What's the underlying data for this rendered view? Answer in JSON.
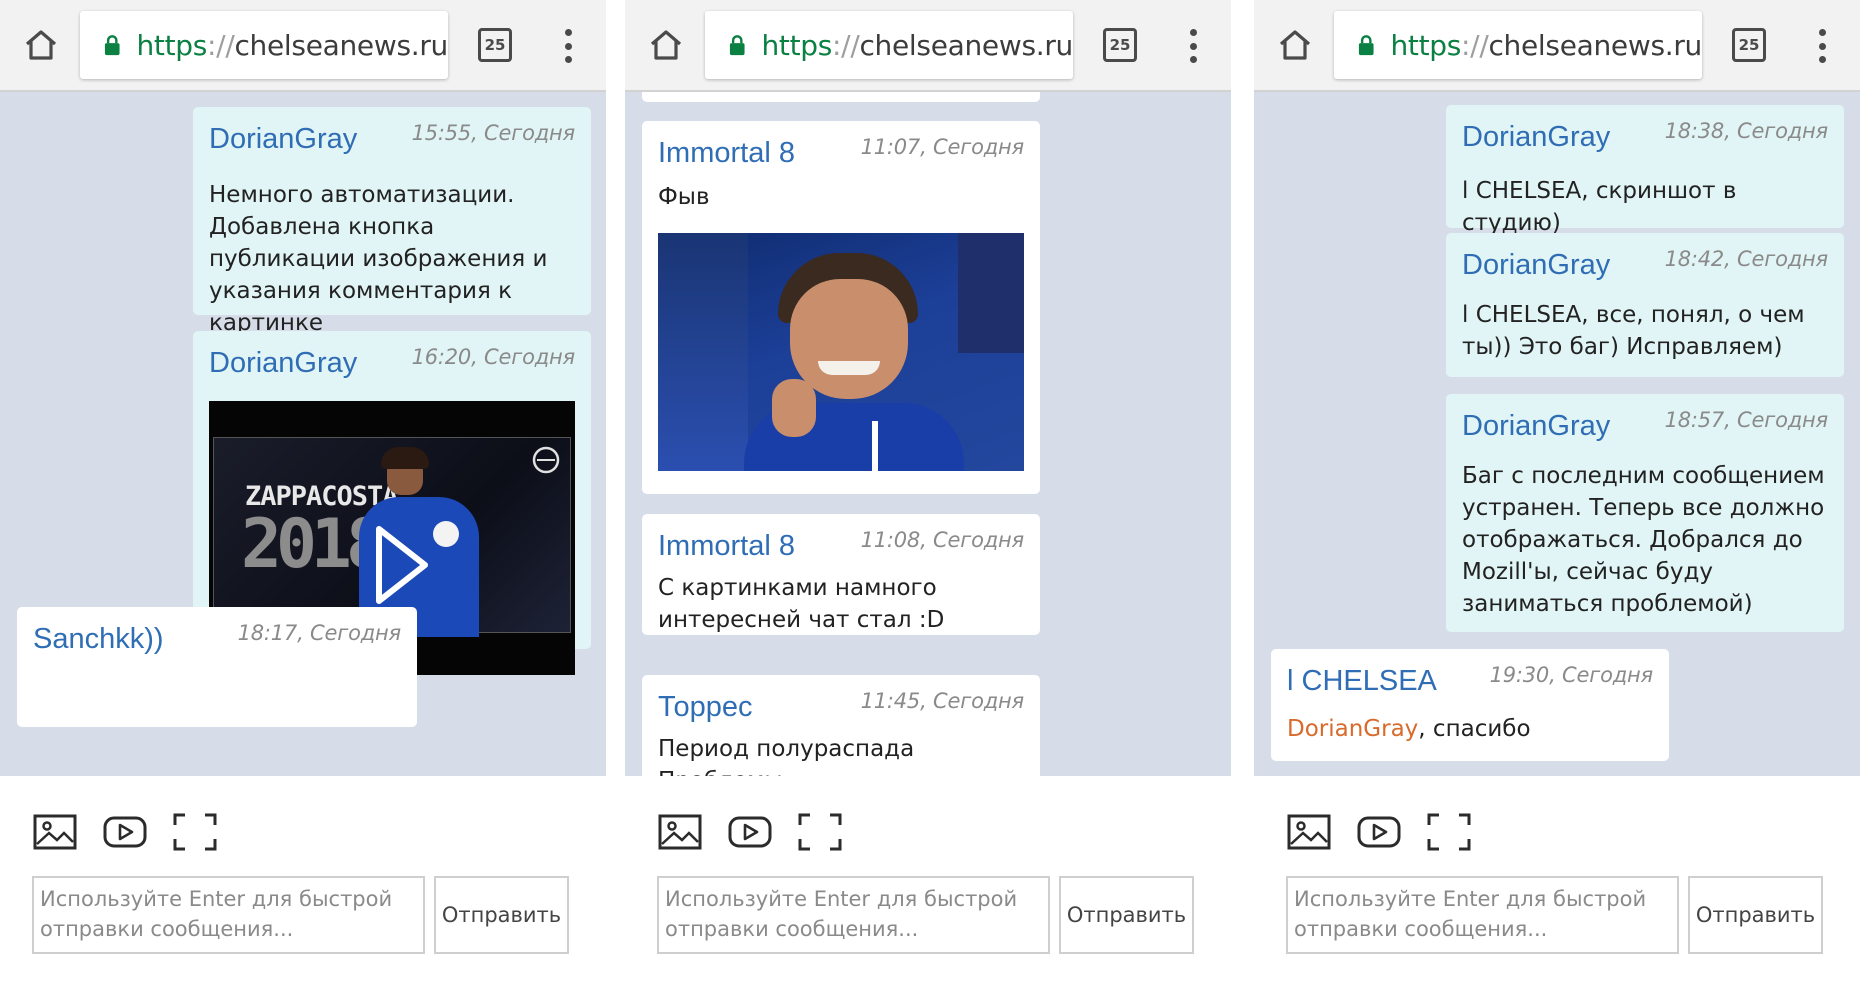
{
  "browser": {
    "url_scheme": "https",
    "url_sep": "://",
    "url_host": "chelseanews.ru",
    "tab_count": "25"
  },
  "composer": {
    "placeholder_line1": "Используйте Enter для быстрой",
    "placeholder_line2": "отправки сообщения...",
    "send_label": "Отправить"
  },
  "panel1": {
    "messages": [
      {
        "author": "DorianGray",
        "time": "15:55, Сегодня",
        "text": "Немного автоматизации. Добавлена кнопка публикации изображения и указания комментария к картинке"
      },
      {
        "author": "DorianGray",
        "time": "16:20, Сегодня",
        "video_title_line1": "ZAPPACOSTA",
        "video_title_line2": "2018"
      },
      {
        "author": "Sanchkk))",
        "time": "18:17, Сегодня"
      }
    ]
  },
  "panel2": {
    "messages": [
      {
        "author": "Immortal 8",
        "time": "11:07, Сегодня",
        "text": "Фыв"
      },
      {
        "author": "Immortal 8",
        "time": "11:08, Сегодня",
        "text": "С картинками намного интересней чат стал :D"
      },
      {
        "author": "Торрес",
        "time": "11:45, Сегодня",
        "text": "Период полураспада Проблемы"
      }
    ]
  },
  "panel3": {
    "messages": [
      {
        "author": "DorianGray",
        "time": "18:38, Сегодня",
        "text": "l CHELSEA, скриншот в студию)"
      },
      {
        "author": "DorianGray",
        "time": "18:42, Сегодня",
        "text": "l CHELSEA, все, понял, о чем ты)) Это баг) Исправляем)"
      },
      {
        "author": "DorianGray",
        "time": "18:57, Сегодня",
        "text": "Баг с последним сообщением устранен. Теперь все должно отображаться. Добрался до Mozill'ы, сейчас буду заниматься проблемой)"
      },
      {
        "author": "l CHELSEA",
        "time": "19:30, Сегодня",
        "mention": "DorianGray",
        "text": ", спасибо"
      }
    ]
  },
  "colors": {
    "accent_link": "#2f6db5",
    "own_bubble": "#e2f5f6",
    "chat_bg": "#d6dde8",
    "secure_green": "#0b8043",
    "mention": "#d96a2b"
  }
}
